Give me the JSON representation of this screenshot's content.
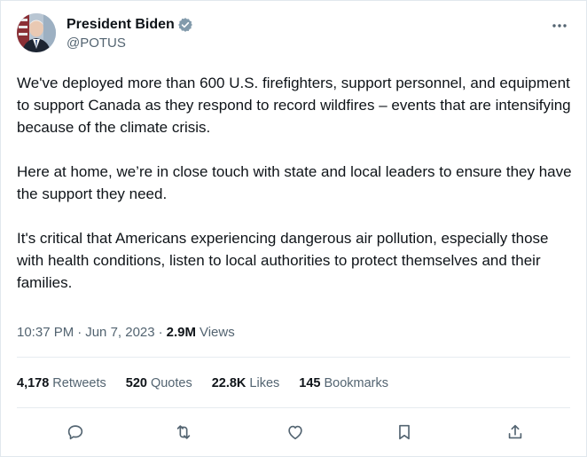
{
  "author": {
    "display_name": "President Biden",
    "handle": "@POTUS",
    "verified_color": "#829aab"
  },
  "tweet": {
    "paragraphs": [
      "We've deployed more than 600 U.S. firefighters, support personnel, and equipment to support Canada as they respond to record wildfires – events that are intensifying because of the climate crisis.",
      "Here at home, we’re in close touch with state and local leaders to ensure they have the support they need.",
      "It's critical that Americans experiencing dangerous air pollution, especially those with health conditions, listen to local authorities to protect themselves and their families."
    ],
    "time": "10:37 PM",
    "date": "Jun 7, 2023",
    "views_count": "2.9M",
    "views_label": "Views",
    "separator": "·"
  },
  "stats": {
    "retweets": {
      "count": "4,178",
      "label": "Retweets"
    },
    "quotes": {
      "count": "520",
      "label": "Quotes"
    },
    "likes": {
      "count": "22.8K",
      "label": "Likes"
    },
    "bookmarks": {
      "count": "145",
      "label": "Bookmarks"
    }
  },
  "actions": [
    "reply-icon",
    "retweet-icon",
    "like-icon",
    "bookmark-icon",
    "share-icon"
  ],
  "colors": {
    "text": "#0f1419",
    "secondary": "#536471",
    "divider": "#e6ecf0"
  }
}
